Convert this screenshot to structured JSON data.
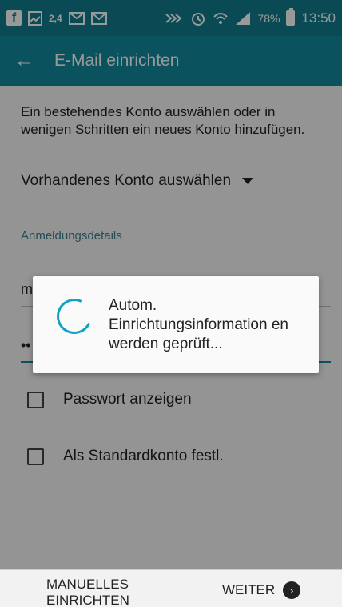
{
  "status_bar": {
    "network_label": "2,4",
    "battery_percent": "78%",
    "time": "13:50",
    "icons": [
      "facebook-icon",
      "gallery-icon",
      "mms-icon",
      "mail-icon",
      "nfc-icon",
      "alarm-icon",
      "wifi-icon",
      "signal-icon",
      "battery-icon"
    ]
  },
  "app_bar": {
    "title": "E-Mail einrichten"
  },
  "main": {
    "intro": "Ein bestehendes Konto auswählen oder in wenigen Schritten ein neues Konto hinzufügen.",
    "account_select": "Vorhandenes Konto auswählen",
    "section_label": "Anmeldungsdetails",
    "email_value": "m",
    "password_value": "••",
    "checkbox_show_password": "Passwort anzeigen",
    "checkbox_default_account": "Als Standardkonto festl."
  },
  "dialog": {
    "message": "Autom. Einrichtungsinformation en werden geprüft..."
  },
  "bottom_bar": {
    "manual_label": "MANUELLES EINRICHTEN",
    "next_label": "WEITER"
  },
  "colors": {
    "status_bar": "#0f7c8e",
    "app_bar": "#12899c",
    "spinner": "#12a1c2"
  }
}
